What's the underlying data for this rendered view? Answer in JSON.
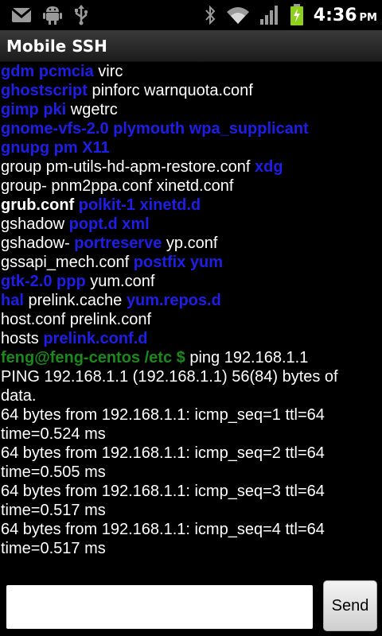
{
  "status_bar": {
    "time": "4:36",
    "ampm": "PM",
    "icons": [
      "gmail-icon",
      "android-debug-icon",
      "usb-icon",
      "bluetooth-icon",
      "wifi-icon",
      "signal-icon",
      "battery-charging-icon"
    ]
  },
  "app": {
    "title": "Mobile SSH"
  },
  "terminal": {
    "colors": {
      "directory": "#1e1ee6",
      "prompt": "#1a8a1a",
      "text": "#ffffff",
      "background": "#000000"
    },
    "lines": [
      [
        {
          "t": "gdm pcmcia",
          "s": "dir"
        },
        {
          "t": " virc",
          "s": "file"
        }
      ],
      [
        {
          "t": "ghostscript",
          "s": "dir"
        },
        {
          "t": " pinforc warnquota.conf",
          "s": "file"
        }
      ],
      [
        {
          "t": "gimp pki",
          "s": "dir"
        },
        {
          "t": " wgetrc",
          "s": "file"
        }
      ],
      [
        {
          "t": "gnome-vfs-2.0 plymouth wpa_supplicant",
          "s": "dir"
        }
      ],
      [
        {
          "t": "gnupg pm X11",
          "s": "dir"
        }
      ],
      [
        {
          "t": "group pm-utils-hd-apm-restore.conf ",
          "s": "file"
        },
        {
          "t": "xdg",
          "s": "dir"
        }
      ],
      [
        {
          "t": "group- pnm2ppa.conf xinetd.conf",
          "s": "file"
        }
      ],
      [
        {
          "t": "grub.conf",
          "s": "bold"
        },
        {
          "t": " ",
          "s": "file"
        },
        {
          "t": "polkit-1 xinetd.d",
          "s": "dir"
        }
      ],
      [
        {
          "t": "gshadow ",
          "s": "file"
        },
        {
          "t": "popt.d xml",
          "s": "dir"
        }
      ],
      [
        {
          "t": "gshadow- ",
          "s": "file"
        },
        {
          "t": "portreserve",
          "s": "dir"
        },
        {
          "t": " yp.conf",
          "s": "file"
        }
      ],
      [
        {
          "t": "gssapi_mech.conf ",
          "s": "file"
        },
        {
          "t": "postfix yum",
          "s": "dir"
        }
      ],
      [
        {
          "t": "gtk-2.0 ppp",
          "s": "dir"
        },
        {
          "t": " yum.conf",
          "s": "file"
        }
      ],
      [
        {
          "t": "hal",
          "s": "dir"
        },
        {
          "t": " prelink.cache ",
          "s": "file"
        },
        {
          "t": "yum.repos.d",
          "s": "dir"
        }
      ],
      [
        {
          "t": "host.conf prelink.conf",
          "s": "file"
        }
      ],
      [
        {
          "t": "hosts ",
          "s": "file"
        },
        {
          "t": "prelink.conf.d",
          "s": "dir"
        }
      ],
      [
        {
          "t": "feng@feng-centos /etc $",
          "s": "prompt"
        },
        {
          "t": " ping 192.168.1.1",
          "s": "file"
        }
      ],
      [
        {
          "t": "PING 192.168.1.1 (192.168.1.1) 56(84) bytes of",
          "s": "file"
        }
      ],
      [
        {
          "t": "data.",
          "s": "file"
        }
      ],
      [
        {
          "t": "64 bytes from 192.168.1.1: icmp_seq=1 ttl=64",
          "s": "file"
        }
      ],
      [
        {
          "t": "time=0.524 ms",
          "s": "file"
        }
      ],
      [
        {
          "t": "64 bytes from 192.168.1.1: icmp_seq=2 ttl=64",
          "s": "file"
        }
      ],
      [
        {
          "t": "time=0.505 ms",
          "s": "file"
        }
      ],
      [
        {
          "t": "64 bytes from 192.168.1.1: icmp_seq=3 ttl=64",
          "s": "file"
        }
      ],
      [
        {
          "t": "time=0.517 ms",
          "s": "file"
        }
      ],
      [
        {
          "t": "64 bytes from 192.168.1.1: icmp_seq=4 ttl=64",
          "s": "file"
        }
      ],
      [
        {
          "t": "time=0.517 ms",
          "s": "file"
        }
      ]
    ]
  },
  "input": {
    "value": "",
    "placeholder": ""
  },
  "send_button": {
    "label": "Send"
  }
}
